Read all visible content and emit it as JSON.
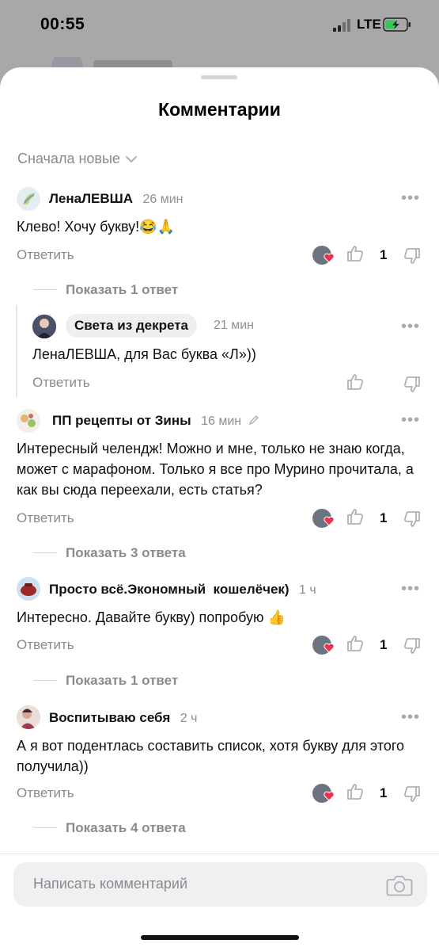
{
  "status": {
    "time": "00:55",
    "network": "LTE"
  },
  "sheet": {
    "title": "Комментарии",
    "sort_label": "Сначала новые"
  },
  "comments": [
    {
      "author": "ЛенаЛЕВША",
      "time": "26 мин",
      "text": "Клево! Хочу букву!😂🙏",
      "reply": "Ответить",
      "likes": "1",
      "show_replies": "Показать 1 ответ"
    },
    {
      "author": "ПП рецепты от Зины",
      "time": "16 мин",
      "text": "Интересный челендж! Можно и мне, только не знаю когда, может с марафоном. Только я все про Мурино прочитала, а как вы сюда переехали, есть статья?",
      "reply": "Ответить",
      "likes": "1",
      "show_replies": "Показать 3 ответа"
    },
    {
      "author": "Просто всё.Экономный  кошелёчек)",
      "time": "1 ч",
      "text": "Интересно. Давайте букву) попробую 👍",
      "reply": "Ответить",
      "likes": "1",
      "show_replies": "Показать 1 ответ"
    },
    {
      "author": "Воспитываю себя",
      "time": "2 ч",
      "text": "А я вот подентлась составить список, хотя букву для этого получила))",
      "reply": "Ответить",
      "likes": "1",
      "show_replies": "Показать 4 ответа"
    }
  ],
  "nested_reply": {
    "author": "Света из декрета",
    "time": "21 мин",
    "text": "ЛенаЛЕВША, для Вас буква «Л»))",
    "reply": "Ответить"
  },
  "composer": {
    "placeholder": "Написать комментарий"
  },
  "colors": {
    "heart": "#e8334a",
    "muted": "#8a8a8e",
    "sheet_bg": "#ffffff"
  }
}
